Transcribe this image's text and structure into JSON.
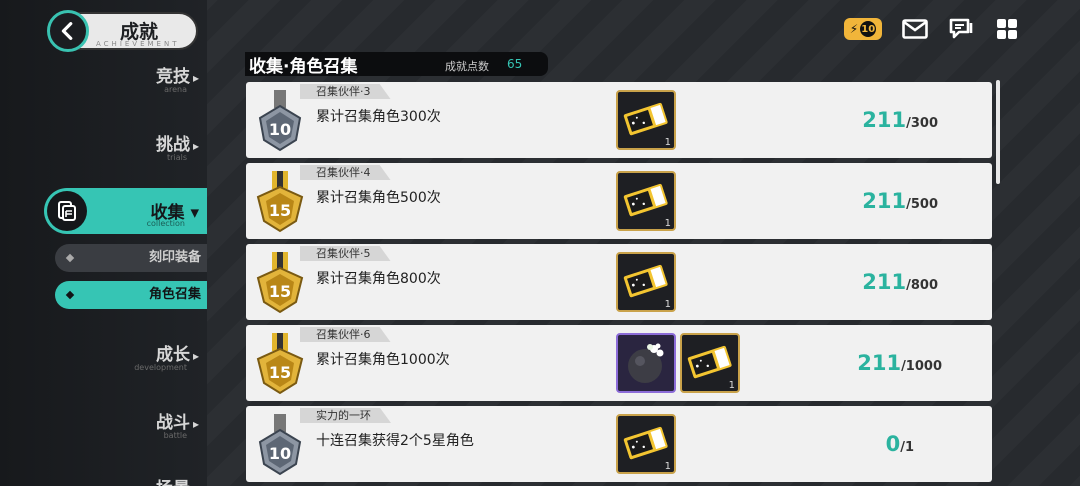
{
  "nav": {
    "back_title": "成就",
    "back_sub": "ACHIEVEMENT",
    "items": [
      {
        "label": "竞技",
        "en": "arena"
      },
      {
        "label": "挑战",
        "en": "trials"
      },
      {
        "label": "收集",
        "en": "collection"
      },
      {
        "label": "成长",
        "en": "development"
      },
      {
        "label": "战斗",
        "en": "battle"
      },
      {
        "label": "场景",
        "en": ""
      }
    ],
    "sub_items": [
      {
        "label": "刻印装备"
      },
      {
        "label": "角色召集"
      }
    ]
  },
  "topbar": {
    "energy": "10"
  },
  "header": {
    "title": "收集·角色召集",
    "points_label": "成就点数",
    "points_value": "65"
  },
  "cards": [
    {
      "tag": "召集伙伴·3",
      "desc": "累计召集角色300次",
      "medal": "10",
      "current": "211",
      "total": "/300",
      "rewards": [
        {
          "type": "ticket",
          "count": "1"
        }
      ]
    },
    {
      "tag": "召集伙伴·4",
      "desc": "累计召集角色500次",
      "medal": "15",
      "current": "211",
      "total": "/500",
      "rewards": [
        {
          "type": "ticket",
          "count": "1"
        }
      ]
    },
    {
      "tag": "召集伙伴·5",
      "desc": "累计召集角色800次",
      "medal": "15",
      "current": "211",
      "total": "/800",
      "rewards": [
        {
          "type": "ticket",
          "count": "1"
        }
      ]
    },
    {
      "tag": "召集伙伴·6",
      "desc": "累计召集角色1000次",
      "medal": "15",
      "current": "211",
      "total": "/1000",
      "rewards": [
        {
          "type": "orb",
          "count": ""
        },
        {
          "type": "ticket",
          "count": "1"
        }
      ]
    },
    {
      "tag": "实力的一环",
      "desc": "十连召集获得2个5星角色",
      "medal": "10",
      "current": "0",
      "total": "/1",
      "rewards": [
        {
          "type": "ticket",
          "count": "1"
        }
      ]
    }
  ],
  "colors": {
    "accent": "#36c5b4",
    "progress": "#2bb39f"
  }
}
